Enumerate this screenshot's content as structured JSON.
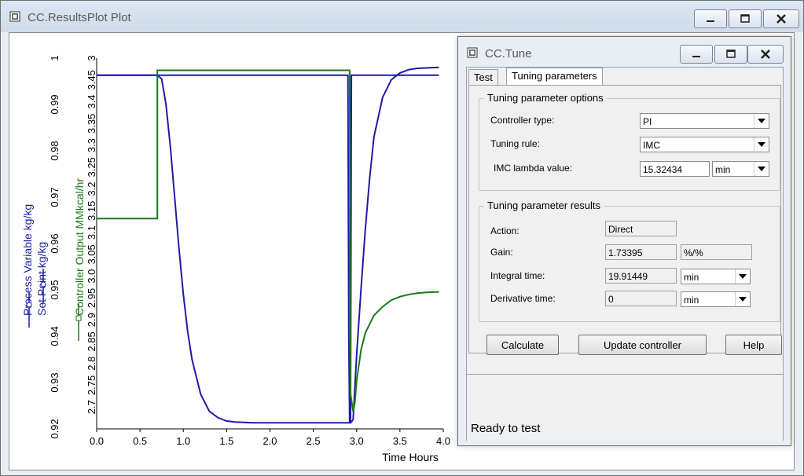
{
  "outer_window": {
    "title": "CC.ResultsPlot Plot"
  },
  "tune_window": {
    "title": "CC.Tune",
    "tabs": [
      {
        "label": "Test"
      },
      {
        "label": "Tuning parameters"
      }
    ],
    "options_group": {
      "title": "Tuning parameter options",
      "controller_type_label": "Controller type:",
      "controller_type_value": "PI",
      "tuning_rule_label": "Tuning rule:",
      "tuning_rule_value": "IMC",
      "lambda_label": "IMC lambda value:",
      "lambda_value": "15.32434",
      "lambda_unit": "min"
    },
    "results_group": {
      "title": "Tuning parameter results",
      "action_label": "Action:",
      "action_value": "Direct",
      "gain_label": "Gain:",
      "gain_value": "1.73395",
      "gain_unit": "%/%",
      "integral_label": "Integral time:",
      "integral_value": "19.91449",
      "integral_unit": "min",
      "derivative_label": "Derivative time:",
      "derivative_value": "0",
      "derivative_unit": "min"
    },
    "buttons": {
      "calculate": "Calculate",
      "update": "Update controller",
      "help": "Help"
    },
    "status": "Ready to test"
  },
  "chart_data": {
    "type": "line",
    "xlabel": "Time Hours",
    "x_ticks": [
      "0.0",
      "0.5",
      "1.0",
      "1.5",
      "2.0",
      "2.5",
      "3.0",
      "3.5",
      "4.0"
    ],
    "xlim": [
      0,
      4.0
    ],
    "y1": {
      "ticks": [
        "0.92",
        "0.93",
        "0.94",
        "0.95",
        "0.96",
        "0.97",
        "0.98",
        "0.99",
        "1"
      ],
      "ylim": [
        0.92,
        1.0
      ],
      "labels": [
        "Process Variable kg/kg",
        "Set Point kg/kg"
      ]
    },
    "y2": {
      "ticks": [
        "2.7",
        "2.75",
        "2.8",
        "2.85",
        "2.9",
        "2.95",
        "3.0",
        "3.05",
        "3.1",
        "3.15",
        "3.2",
        "3.25",
        "3.3",
        "3.35",
        "3.4",
        "3.45",
        "3"
      ],
      "ylim": [
        2.65,
        3.5
      ],
      "label": "Controller Output MMkcal/hr"
    },
    "colors": {
      "pv": "#1c1ca8",
      "sp": "#1c1ca8",
      "co": "#1a7a1a"
    },
    "series": [
      {
        "name": "Process Variable kg/kg",
        "axis": "y1",
        "x": [
          0,
          0.7,
          0.75,
          0.8,
          0.85,
          0.9,
          0.95,
          1.0,
          1.05,
          1.1,
          1.2,
          1.3,
          1.4,
          1.5,
          1.6,
          1.8,
          2.0,
          2.5,
          2.92,
          2.94,
          2.96,
          3.0,
          3.05,
          3.1,
          3.15,
          3.2,
          3.3,
          3.4,
          3.5,
          3.6,
          3.7,
          3.95
        ],
        "y": [
          0.9963,
          0.9963,
          0.9955,
          0.99,
          0.981,
          0.97,
          0.959,
          0.949,
          0.941,
          0.935,
          0.9275,
          0.9238,
          0.9224,
          0.9217,
          0.9215,
          0.9213,
          0.9213,
          0.9213,
          0.9213,
          0.9215,
          0.922,
          0.936,
          0.95,
          0.963,
          0.974,
          0.983,
          0.9915,
          0.9953,
          0.9968,
          0.9975,
          0.9978,
          0.998
        ]
      },
      {
        "name": "Set Point kg/kg",
        "axis": "y1",
        "x": [
          0,
          2.9,
          2.91,
          2.92,
          2.93,
          2.94,
          3.95
        ],
        "y": [
          0.9963,
          0.9963,
          0.94,
          0.9213,
          0.9213,
          0.9963,
          0.9963
        ]
      },
      {
        "name": "Controller Output MMkcal/hr",
        "axis": "y2",
        "x": [
          0,
          0.7,
          0.7,
          2.92,
          2.93,
          2.96,
          2.98,
          3.0,
          3.05,
          3.1,
          3.2,
          3.3,
          3.4,
          3.5,
          3.6,
          3.7,
          3.8,
          3.95
        ],
        "y": [
          3.132,
          3.132,
          3.472,
          3.472,
          2.73,
          2.69,
          2.71,
          2.76,
          2.83,
          2.87,
          2.91,
          2.93,
          2.945,
          2.953,
          2.958,
          2.961,
          2.963,
          2.964
        ]
      }
    ]
  }
}
